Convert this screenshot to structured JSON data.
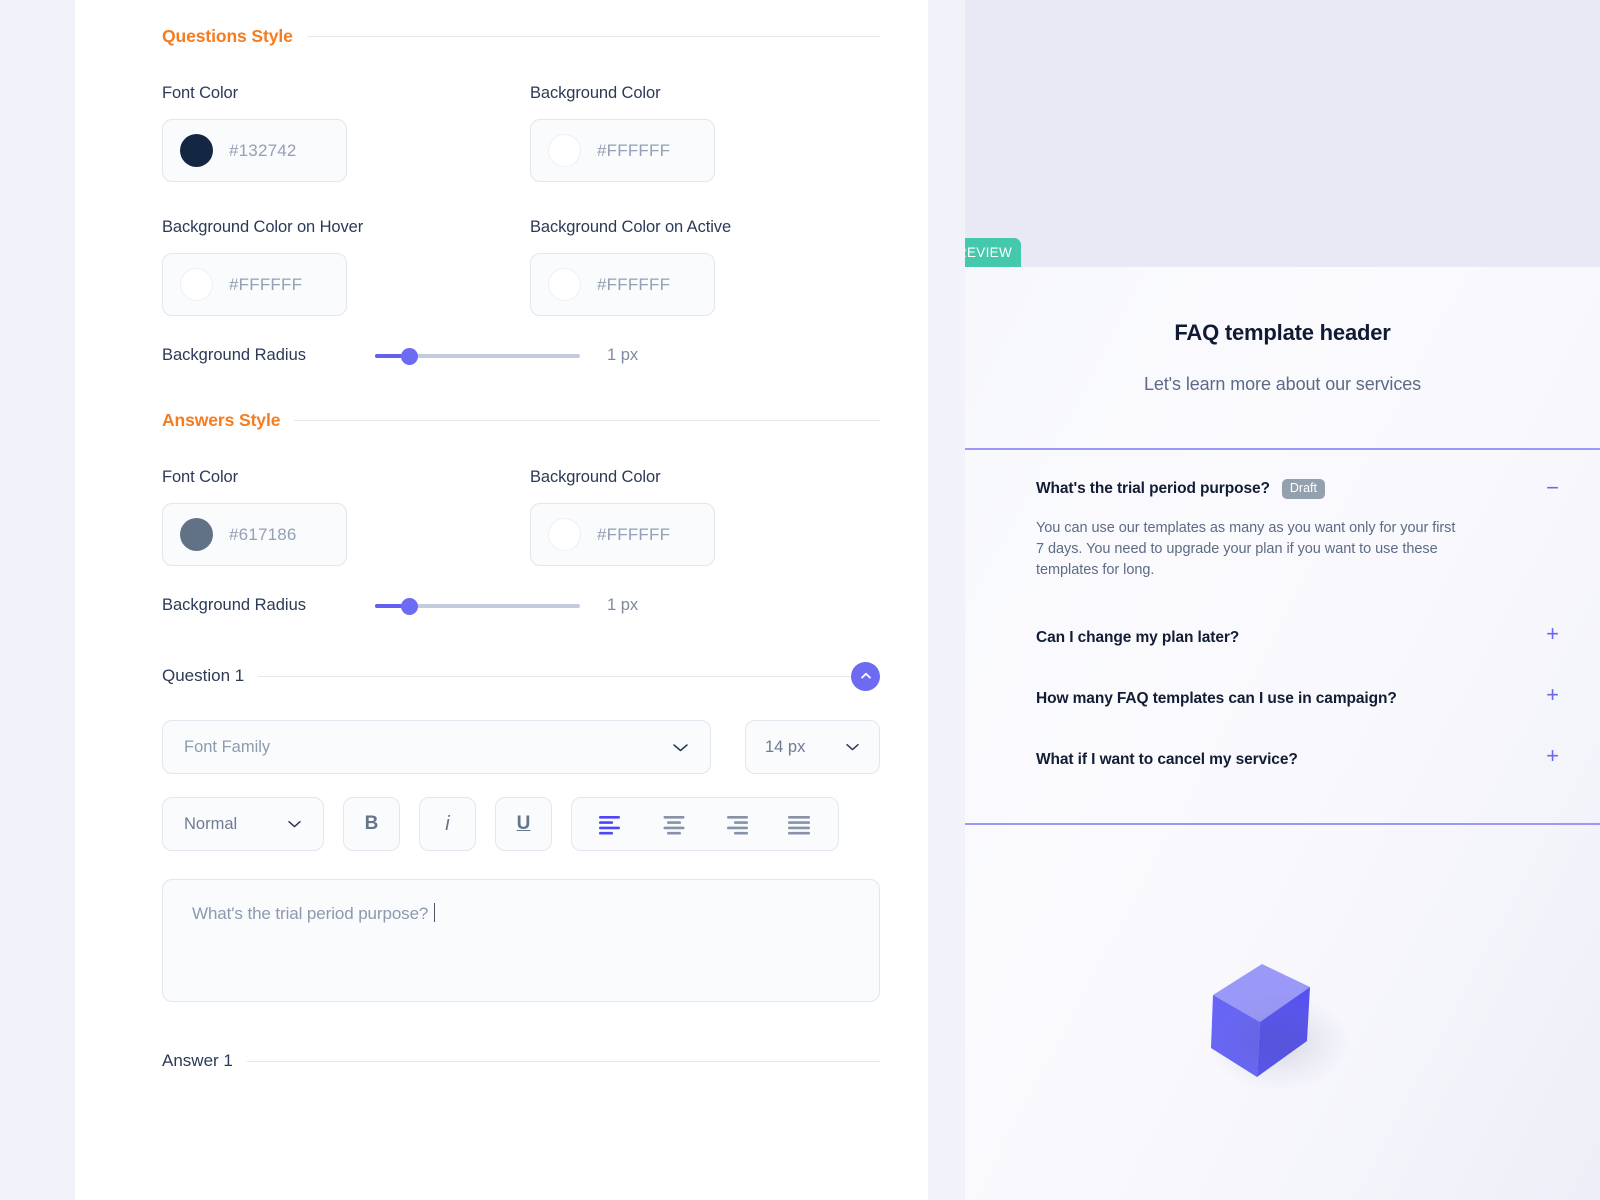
{
  "editor": {
    "sections": [
      {
        "title": "Questions Style",
        "fields": {
          "font_color_label": "Font Color",
          "font_color_value": "#132742",
          "font_color_swatch": "#132742",
          "bg_color_label": "Background Color",
          "bg_color_value": "#FFFFFF",
          "bg_hover_label": "Background Color on Hover",
          "bg_hover_value": "#FFFFFF",
          "bg_active_label": "Background Color on Active",
          "bg_active_value": "#FFFFFF",
          "radius_label": "Background Radius",
          "radius_value": "1 px"
        }
      },
      {
        "title": "Answers Style",
        "fields": {
          "font_color_label": "Font Color",
          "font_color_value": "#617186",
          "font_color_swatch": "#617186",
          "bg_color_label": "Background Color",
          "bg_color_value": "#FFFFFF",
          "radius_label": "Background Radius",
          "radius_value": "1 px"
        }
      }
    ],
    "question_block": {
      "title": "Question 1",
      "font_family_placeholder": "Font Family",
      "font_size_value": "14 px",
      "font_weight_value": "Normal",
      "bold_label": "B",
      "italic_label": "i",
      "underline_label": "U",
      "align_options": [
        "align-left",
        "align-center",
        "align-right",
        "align-justify"
      ],
      "align_active_index": 0,
      "question_text": "What's the trial period purpose?"
    },
    "answer_block": {
      "title": "Answer 1"
    }
  },
  "preview": {
    "tag_label": "PREVIEW",
    "tag_color": "#44c9ac",
    "header_title": "FAQ template header",
    "header_subtitle": "Let's learn more about our services",
    "divider_color": "#9c97fa",
    "accent_color": "#6b68f0",
    "faq_items": [
      {
        "question": "What's the trial period purpose?",
        "badge": "Draft",
        "toggle": "−",
        "expanded": true,
        "answer": "You can use our templates as many as you want only for your first 7 days. You need to upgrade your plan if you want to use these templates for long."
      },
      {
        "question": "Can I change my plan later?",
        "badge": "",
        "toggle": "+",
        "expanded": false,
        "answer": ""
      },
      {
        "question": "How many FAQ templates can I use in campaign?",
        "badge": "",
        "toggle": "+",
        "expanded": false,
        "answer": ""
      },
      {
        "question": "What if I want to cancel my service?",
        "badge": "",
        "toggle": "+",
        "expanded": false,
        "answer": ""
      }
    ],
    "illustration": "cube-3d"
  }
}
